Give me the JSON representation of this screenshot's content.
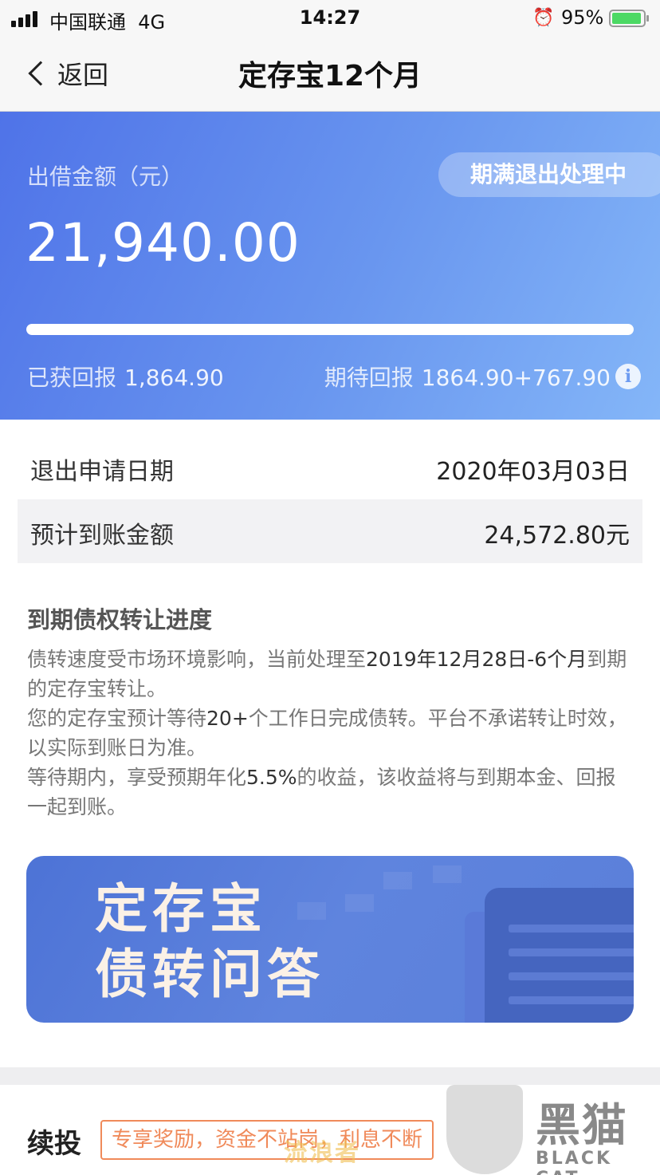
{
  "status_bar": {
    "carrier": "中国联通",
    "network": "4G",
    "time": "14:27",
    "battery_percent": "95%",
    "battery_level": 0.95
  },
  "nav": {
    "back_label": "返回",
    "title": "定存宝12个月"
  },
  "hero": {
    "amount_label": "出借金额（元）",
    "status_badge": "期满退出处理中",
    "amount": "21,940.00",
    "progress_fraction": 1.0,
    "earned_label": "已获回报",
    "earned_value": "1,864.90",
    "expected_label": "期待回报",
    "expected_value": "1864.90+767.90",
    "info_icon": "i"
  },
  "details": {
    "rows": [
      {
        "label": "退出申请日期",
        "value": "2020年03月03日"
      },
      {
        "label": "预计到账金额",
        "value": "24,572.80元"
      }
    ]
  },
  "transfer": {
    "title": "到期债权转让进度",
    "p1_a": "债转速度受市场环境影响，当前处理至",
    "p1_hl": "2019年12月28日-6个月",
    "p1_b": "到期的定存宝转让。",
    "p2_a": "您的定存宝预计等待",
    "p2_hl": "20+",
    "p2_b": "个工作日完成债转。平台不承诺转让时效，以实际到账日为准。",
    "p3_a": "等待期内，享受预期年化",
    "p3_hl": "5.5%",
    "p3_b": "的收益，该收益将与到期本金、回报一起到账。"
  },
  "banner": {
    "line1": "定存宝",
    "line2": "债转问答"
  },
  "reinvest": {
    "label": "续投",
    "tag": "专享奖励，资金不站岗，利息不断"
  },
  "watermark": {
    "cn": "黑猫",
    "en": "BLACK CAT",
    "sub": "流浪者"
  },
  "colors": {
    "hero_start": "#4f73e8",
    "hero_end": "#84b6f8",
    "tag_orange": "#f08a5a",
    "banner_text": "#fbf1e6"
  }
}
